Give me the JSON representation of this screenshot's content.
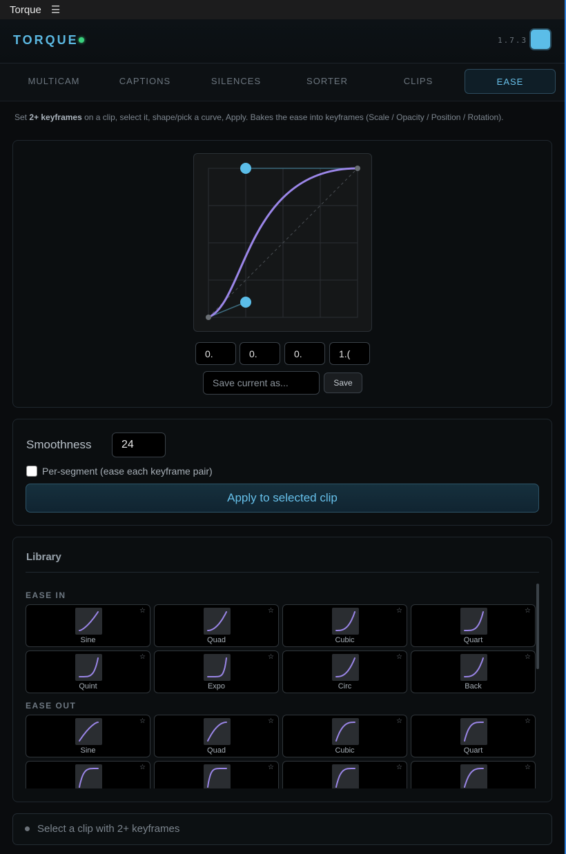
{
  "window": {
    "title": "Torque",
    "menu_icon": "hamburger-icon"
  },
  "header": {
    "brand": "TORQUE",
    "version": "1.7.3",
    "status_color": "#3ad17e",
    "swatch_color": "#5bbde8"
  },
  "tabs": [
    {
      "label": "MULTICAM",
      "active": false
    },
    {
      "label": "CAPTIONS",
      "active": false
    },
    {
      "label": "SILENCES",
      "active": false
    },
    {
      "label": "SORTER",
      "active": false
    },
    {
      "label": "CLIPS",
      "active": false
    },
    {
      "label": "EASE",
      "active": true
    }
  ],
  "description": {
    "prefix": "Set ",
    "bold": "2+ keyframes",
    "suffix": " on a clip, select it, shape/pick a curve, Apply. Bakes the ease into keyframes (Scale / Opacity / Position / Rotation)."
  },
  "curve_editor": {
    "bezier": [
      "0.",
      "0.",
      "0.",
      "1.("
    ],
    "preset_placeholder": "Save current as...",
    "save_label": "Save",
    "curve_color": "#9b86e8",
    "handle_color": "#5bbde8"
  },
  "settings": {
    "smoothness_label": "Smoothness",
    "smoothness_value": "24",
    "per_segment_label": "Per-segment (ease each keyframe pair)",
    "per_segment_checked": false,
    "apply_label": "Apply to selected clip"
  },
  "library": {
    "title": "Library",
    "sections": [
      {
        "title": "EASE IN",
        "items": [
          {
            "name": "Sine",
            "kind": "in",
            "p": 1.5
          },
          {
            "name": "Quad",
            "kind": "in",
            "p": 2
          },
          {
            "name": "Cubic",
            "kind": "in",
            "p": 3
          },
          {
            "name": "Quart",
            "kind": "in",
            "p": 4
          },
          {
            "name": "Quint",
            "kind": "in",
            "p": 5
          },
          {
            "name": "Expo",
            "kind": "in",
            "p": 8
          },
          {
            "name": "Circ",
            "kind": "in",
            "p": 2.5
          },
          {
            "name": "Back",
            "kind": "in",
            "p": 3
          }
        ]
      },
      {
        "title": "EASE OUT",
        "items": [
          {
            "name": "Sine",
            "kind": "out",
            "p": 1.5
          },
          {
            "name": "Quad",
            "kind": "out",
            "p": 2
          },
          {
            "name": "Cubic",
            "kind": "out",
            "p": 3
          },
          {
            "name": "Quart",
            "kind": "out",
            "p": 4
          },
          {
            "name": "",
            "kind": "out",
            "p": 5
          },
          {
            "name": "",
            "kind": "out",
            "p": 7
          },
          {
            "name": "",
            "kind": "out",
            "p": 4.5
          },
          {
            "name": "",
            "kind": "out",
            "p": 3.5
          }
        ]
      }
    ]
  },
  "status": {
    "text": "Select a clip with 2+ keyframes"
  }
}
